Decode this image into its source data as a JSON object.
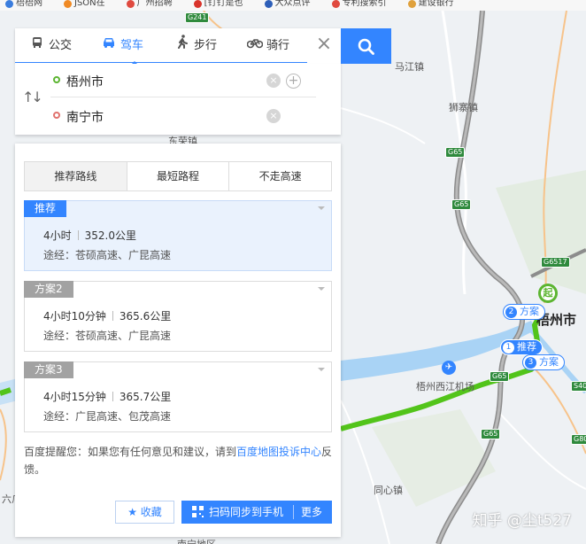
{
  "bookmarks": [
    {
      "label": "梧梧网",
      "color": "#3b7ddd"
    },
    {
      "label": "JSON在",
      "color": "#f08a24"
    },
    {
      "label": "广州招聘",
      "color": "#e04a3f"
    },
    {
      "label": "[钉钉是也",
      "color": "#d9342b"
    },
    {
      "label": "大众点评",
      "color": "#2e5fb8"
    },
    {
      "label": "专利搜索引",
      "color": "#e04a3f"
    },
    {
      "label": "建设银行",
      "color": "#e0a13c"
    }
  ],
  "map": {
    "places": {
      "majiang": "马江镇",
      "shizhai": "狮寨镇",
      "dongrong": "东荣镇",
      "tongxin": "同心镇",
      "liuxu": "六爪",
      "airport": "梧州西江机场",
      "city": "梧州市",
      "south": "南宁地区"
    },
    "shields": {
      "g241": "G241",
      "g65_a": "G65",
      "g65_b": "G65",
      "g6517": "G6517",
      "g65_c": "G65",
      "g65_d": "G65",
      "s40": "S40",
      "g80": "G80"
    },
    "start_marker": "起",
    "tags": {
      "recommend": {
        "num": "1",
        "label": "推荐"
      },
      "plan2": {
        "num": "2",
        "label": "方案"
      },
      "plan3": {
        "num": "3",
        "label": "方案"
      }
    },
    "airport_icon": "airplane-icon"
  },
  "watermark": "知乎 @尘t527",
  "modes": {
    "bus": {
      "label": "公交",
      "icon": "bus-icon"
    },
    "drive": {
      "label": "驾车",
      "icon": "car-icon"
    },
    "walk": {
      "label": "步行",
      "icon": "walk-icon"
    },
    "bike": {
      "label": "骑行",
      "icon": "bike-icon"
    }
  },
  "origin": "梧州市",
  "destination": "南宁市",
  "preferences": [
    "推荐路线",
    "最短路程",
    "不走高速"
  ],
  "routes": [
    {
      "label": "推荐",
      "time": "4小时",
      "distance": "352.0公里",
      "via": "途经：苍硕高速、广昆高速"
    },
    {
      "label": "方案2",
      "time": "4小时10分钟",
      "distance": "365.6公里",
      "via": "途经：苍硕高速、广昆高速"
    },
    {
      "label": "方案3",
      "time": "4小时15分钟",
      "distance": "365.7公里",
      "via": "途经：广昆高速、包茂高速"
    }
  ],
  "tip": {
    "before": "百度提醒您：如果您有任何意见和建议，请到",
    "link": "百度地图投诉中心",
    "after": "反馈。"
  },
  "actions": {
    "favorite": "收藏",
    "sync": "扫码同步到手机",
    "more": "更多"
  },
  "colors": {
    "accent": "#3385ff",
    "route_green": "#52c41a",
    "start_green": "#5cb531",
    "highway_gray": "#8c8c8c"
  }
}
